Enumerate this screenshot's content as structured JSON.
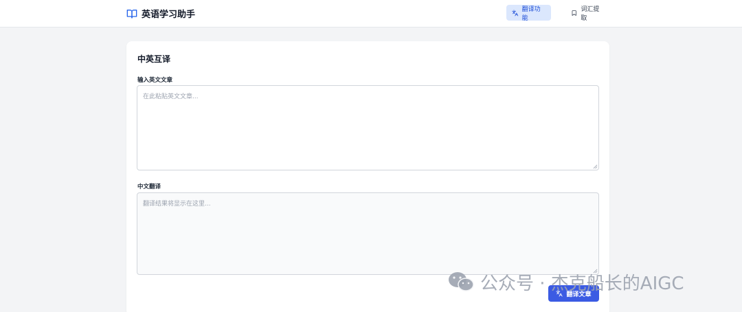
{
  "header": {
    "title": "英语学习助手",
    "nav": [
      {
        "label": "翻译功能",
        "active": true
      },
      {
        "label": "词汇提取",
        "active": false
      }
    ]
  },
  "card": {
    "title": "中英互译",
    "input_label": "输入英文文章",
    "input_placeholder": "在此粘贴英文文章...",
    "output_label": "中文翻译",
    "output_placeholder": "翻译结果将显示在这里...",
    "action_label": "翻译文章"
  },
  "watermark": {
    "text": "公众号 · 杰克船长的AIGC"
  },
  "colors": {
    "accent": "#3b5be3",
    "nav_active_bg": "#dbe7fd",
    "page_bg": "#f3f4f6"
  }
}
